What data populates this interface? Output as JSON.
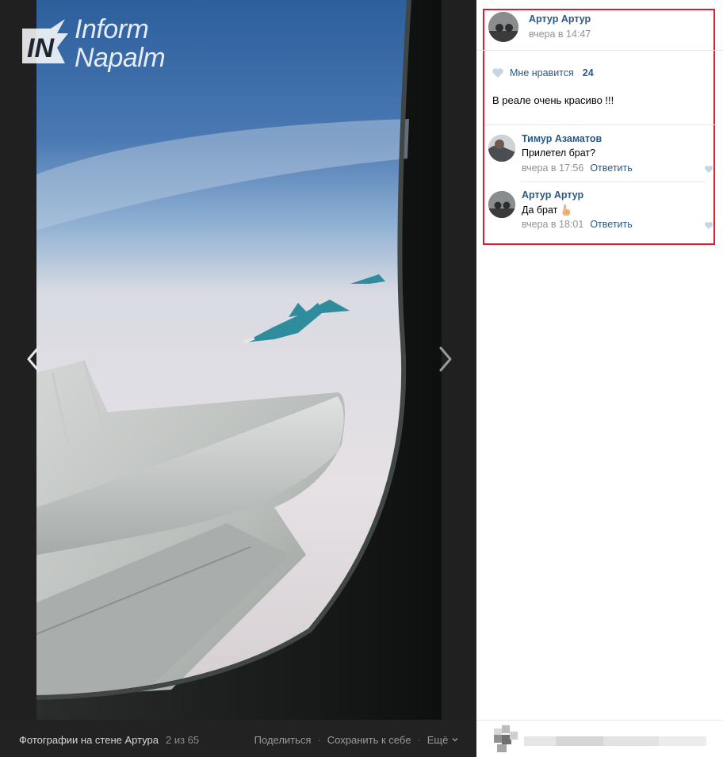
{
  "viewer": {
    "watermark": {
      "line1": "Inform",
      "line2": "Napalm",
      "mark": "IN"
    },
    "footer": {
      "album_title": "Фотографии на стене Артура",
      "album_count": "2 из 65",
      "share": "Поделиться",
      "save": "Сохранить к себе",
      "more": "Ещё"
    }
  },
  "post": {
    "author": "Артур Артур",
    "time": "вчера в 14:47",
    "like_label": "Мне нравится",
    "like_count": "24",
    "caption": "В реале очень красиво !!!"
  },
  "comments": [
    {
      "author": "Тимур Азаматов",
      "text": "Прилетел брат?",
      "time": "вчера в 17:56",
      "reply": "Ответить",
      "emoji": ""
    },
    {
      "author": "Артур Артур",
      "text": "Да брат",
      "time": "вчера в 18:01",
      "reply": "Ответить",
      "emoji": "pointing-up-hand"
    }
  ],
  "colors": {
    "highlight": "#d71f32",
    "link": "#2a5885",
    "muted": "#939393"
  }
}
